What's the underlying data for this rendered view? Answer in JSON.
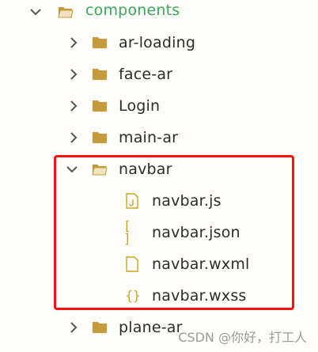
{
  "tree": {
    "root": {
      "label": "components",
      "expanded": true
    },
    "folders": [
      {
        "label": "ar-loading"
      },
      {
        "label": "face-ar"
      },
      {
        "label": "Login"
      },
      {
        "label": "main-ar"
      }
    ],
    "navbar": {
      "label": "navbar",
      "expanded": true,
      "files": [
        {
          "label": "navbar.js",
          "icon": "js-file-icon",
          "glyph": "J"
        },
        {
          "label": "navbar.json",
          "icon": "json-file-icon",
          "glyph": "[ ]"
        },
        {
          "label": "navbar.wxml",
          "icon": "wxml-file-icon",
          "glyph": ""
        },
        {
          "label": "navbar.wxss",
          "icon": "wxss-file-icon",
          "glyph": "{}"
        }
      ]
    },
    "after": {
      "label": "plane-ar"
    }
  },
  "watermark": "CSDN @你好，打工人",
  "colors": {
    "accent": "#3aa65b",
    "highlight": "#ff1010",
    "folder": "#c49a3a",
    "file": "#c9a227"
  }
}
